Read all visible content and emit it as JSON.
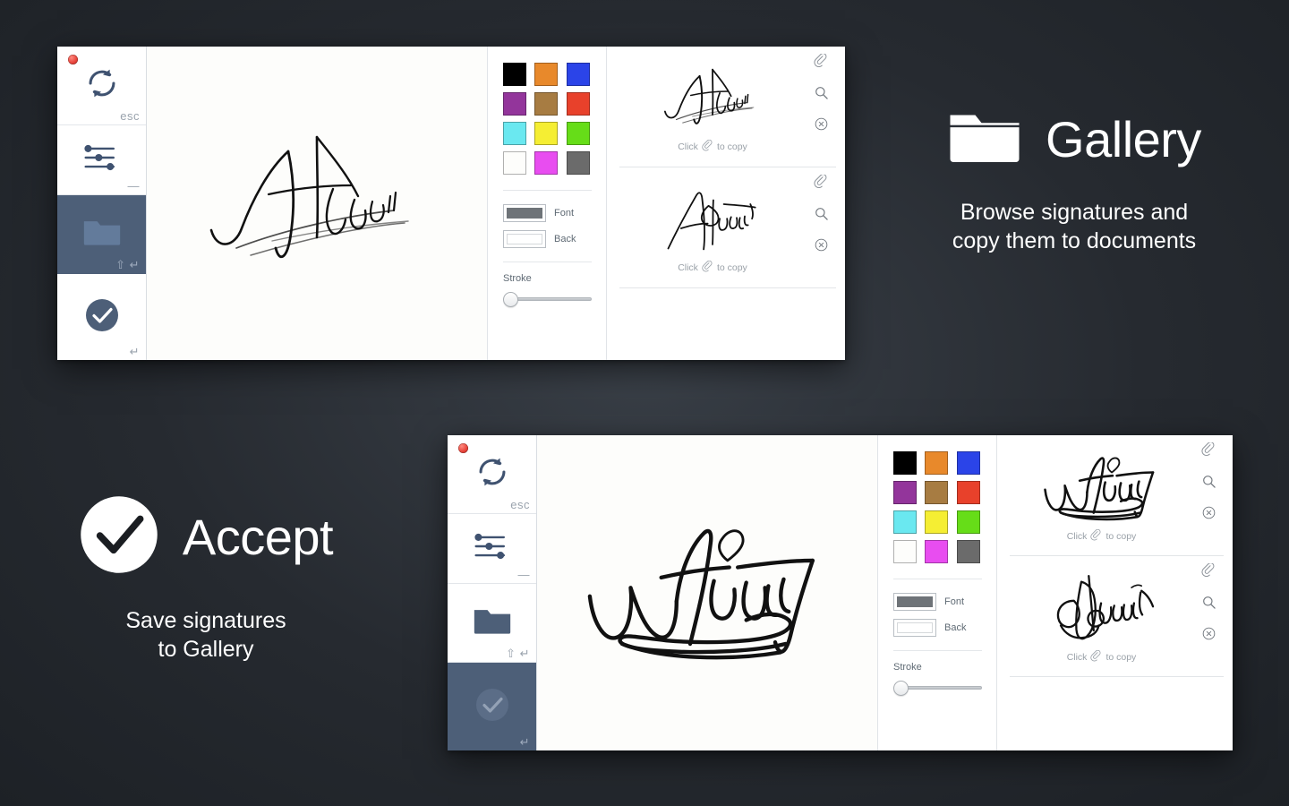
{
  "background": {
    "color": "#2b3037"
  },
  "palette": {
    "accent": "#4d5f78",
    "swatches": [
      {
        "name": "black",
        "hex": "#000000"
      },
      {
        "name": "orange",
        "hex": "#e8892b"
      },
      {
        "name": "blue",
        "hex": "#2b44e8"
      },
      {
        "name": "purple",
        "hex": "#93359b"
      },
      {
        "name": "brown",
        "hex": "#a77c42"
      },
      {
        "name": "red",
        "hex": "#e8412b"
      },
      {
        "name": "cyan",
        "hex": "#6ae8f0"
      },
      {
        "name": "yellow",
        "hex": "#f5ee33"
      },
      {
        "name": "green",
        "hex": "#66dd18"
      },
      {
        "name": "white",
        "hex": "#fdfdfb"
      },
      {
        "name": "magenta",
        "hex": "#e84df0"
      },
      {
        "name": "gray",
        "hex": "#6b6b6b"
      }
    ],
    "font_label": "Font",
    "font_color": "#6e7378",
    "back_label": "Back",
    "back_color": "#ffffff",
    "stroke_label": "Stroke",
    "stroke_value": 0
  },
  "sidebar": {
    "items": [
      {
        "name": "reset",
        "icon": "refresh-icon",
        "hint": "esc",
        "active": false
      },
      {
        "name": "tools",
        "icon": "sliders-icon",
        "hint": "—",
        "active": false
      },
      {
        "name": "gallery",
        "icon": "folder-icon",
        "hint": "⇧ ↵",
        "active": true
      },
      {
        "name": "accept",
        "icon": "check-icon",
        "hint": "↵",
        "active": false
      }
    ]
  },
  "windows": [
    {
      "id": "window-gallery",
      "active_sidebar_item": "gallery",
      "canvas_signature": "signature-stroke-1",
      "gallery_items": [
        {
          "caption_before": "Click",
          "caption_after": "to copy",
          "signature": "signature-stroke-1"
        },
        {
          "caption_before": "Click",
          "caption_after": "to copy",
          "signature": "signature-stroke-2"
        }
      ]
    },
    {
      "id": "window-accept",
      "active_sidebar_item": "accept",
      "canvas_signature": "signature-stroke-3",
      "gallery_items": [
        {
          "caption_before": "Click",
          "caption_after": "to copy",
          "signature": "signature-stroke-3"
        },
        {
          "caption_before": "Click",
          "caption_after": "to copy",
          "signature": "signature-stroke-4"
        }
      ]
    }
  ],
  "promos": [
    {
      "id": "promo-gallery",
      "icon": "folder-icon",
      "title": "Gallery",
      "subtitle": "Browse signatures and\ncopy them to documents"
    },
    {
      "id": "promo-accept",
      "icon": "check-circle-icon",
      "title": "Accept",
      "subtitle": "Save signatures\nto Gallery"
    }
  ]
}
